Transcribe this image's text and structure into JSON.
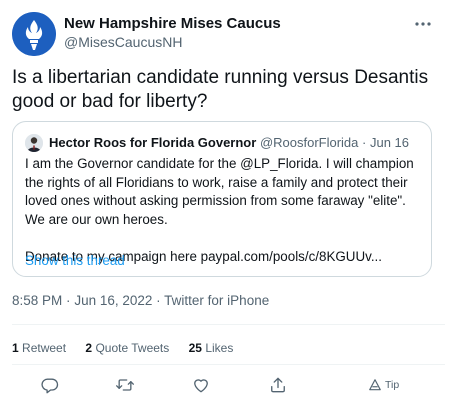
{
  "tweet": {
    "author": {
      "name": "New Hampshire Mises Caucus",
      "handle": "@MisesCaucusNH",
      "avatar": "torch-logo"
    },
    "text": "Is a libertarian candidate running versus Desantis good or bad for liberty?",
    "timestamp": "8:58 PM",
    "date": "Jun 16, 2022",
    "source": "Twitter for iPhone",
    "separator": "·",
    "stats": {
      "retweets": {
        "count": "1",
        "label": "Retweet"
      },
      "quotes": {
        "count": "2",
        "label": "Quote Tweets"
      },
      "likes": {
        "count": "25",
        "label": "Likes"
      }
    },
    "actions": {
      "reply_icon": "reply-icon",
      "retweet_icon": "retweet-icon",
      "like_icon": "heart-icon",
      "share_icon": "share-icon",
      "tip_label": "Tip"
    }
  },
  "quoted": {
    "name": "Hector Roos for Florida Governor",
    "handle": "@RoosforFlorida",
    "date": "Jun 16",
    "body_para1": "I am the Governor candidate for the @LP_Florida. I will champion the rights of all Floridians to work, raise a family and protect their loved ones without asking permission from some faraway \"elite\". We are our own heroes.",
    "body_para2": "Donate to my campaign here paypal.com/pools/c/8KGUUv...",
    "show_thread": "Show this thread"
  },
  "colors": {
    "text": "#0f1419",
    "secondary": "#536471",
    "link": "#1d9bf0",
    "border": "#cfd9de",
    "avatar_bg": "#1d5fbf"
  }
}
